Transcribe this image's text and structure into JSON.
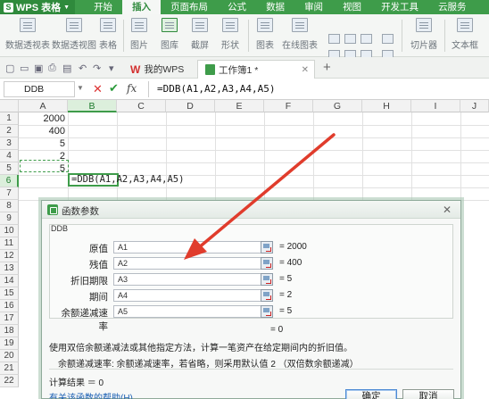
{
  "app": {
    "name": "WPS 表格",
    "logo": "S"
  },
  "menu_tabs": [
    "开始",
    "插入",
    "页面布局",
    "公式",
    "数据",
    "审阅",
    "视图",
    "开发工具",
    "云服务"
  ],
  "ribbon": {
    "pivot_table": "数据透视表",
    "pivot_chart": "数据透视图",
    "table": "表格",
    "picture": "图片",
    "gallery": "图库",
    "screenshot": "截屏",
    "shapes": "形状",
    "chart": "图表",
    "online_chart": "在线图表",
    "slicer": "切片器",
    "textbox": "文本框"
  },
  "doc_tabs": {
    "wps_home": "我的WPS",
    "workbook": "工作簿1 *"
  },
  "formula_bar": {
    "name_box": "DDB",
    "fx": "fx",
    "formula": "=DDB(A1,A2,A3,A4,A5)"
  },
  "sheet": {
    "columns": [
      "A",
      "B",
      "C",
      "D",
      "E",
      "F",
      "G",
      "H",
      "I",
      "J"
    ],
    "rows": [
      "1",
      "2",
      "3",
      "4",
      "5",
      "6",
      "7",
      "8",
      "9",
      "10",
      "11",
      "12",
      "13",
      "14",
      "15",
      "16",
      "17",
      "18",
      "19",
      "20",
      "21",
      "22"
    ],
    "a_values": [
      "2000",
      "400",
      "5",
      "2",
      "5"
    ],
    "b6_edit": "=DDB(A1,A2,A3,A4,A5)"
  },
  "dialog": {
    "title": "函数参数",
    "function_name": "DDB",
    "args": [
      {
        "label": "原值",
        "ref": "A1",
        "result": "= 2000"
      },
      {
        "label": "残值",
        "ref": "A2",
        "result": "= 400"
      },
      {
        "label": "折旧期限",
        "ref": "A3",
        "result": "= 5"
      },
      {
        "label": "期间",
        "ref": "A4",
        "result": "= 2"
      },
      {
        "label": "余额递减速率",
        "ref": "A5",
        "result": "= 5"
      }
    ],
    "overall_result": "= 0",
    "description": "使用双倍余额递减法或其他指定方法，计算一笔资产在给定期间内的折旧值。",
    "arg_description": "余额递减速率:   余额递减速率，若省略，则采用默认值 2 （双倍数余额递减）",
    "calc_result": "计算结果 ＝ 0",
    "help_link": "有关该函数的帮助(H)",
    "ok": "确定",
    "cancel": "取消"
  },
  "colors": {
    "accent": "#3e9c4a",
    "arrow": "#e03c2c"
  }
}
